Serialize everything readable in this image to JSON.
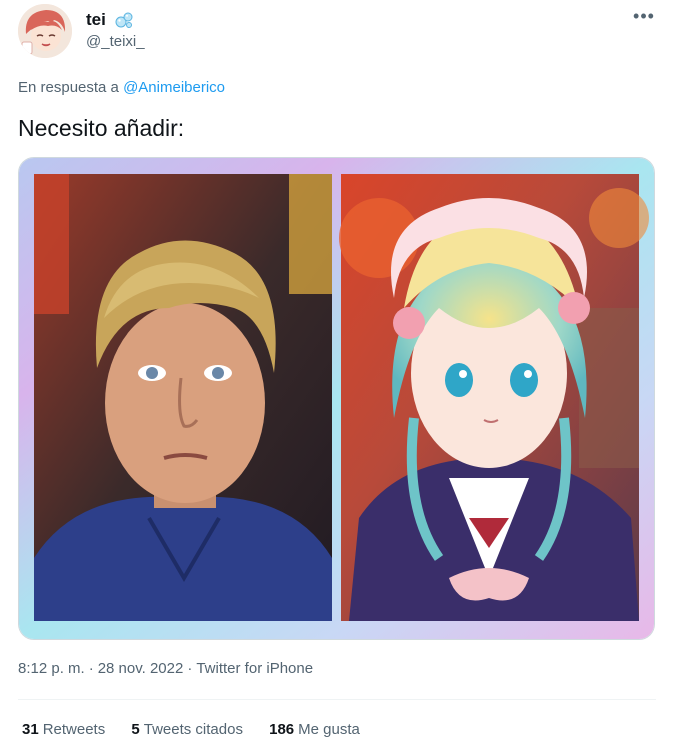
{
  "author": {
    "display_name": "tei",
    "name_emoji_icon": "bubbles-icon",
    "handle": "@_teixi_",
    "avatar_icon": "anime-avatar"
  },
  "reply": {
    "prefix": "En respuesta a",
    "mention": "@Animeiberico"
  },
  "tweet": {
    "text": "Necesito añadir:",
    "media_description_left": "photo",
    "media_description_right": "anime illustration"
  },
  "meta": {
    "time": "8:12 p. m.",
    "date": "28 nov. 2022",
    "client": "Twitter for iPhone",
    "separator": "·"
  },
  "stats": {
    "retweets_count": "31",
    "retweets_label": "Retweets",
    "quotes_count": "5",
    "quotes_label": "Tweets citados",
    "likes_count": "186",
    "likes_label": "Me gusta"
  },
  "colors": {
    "link": "#1d9bf0",
    "secondary_text": "#536471",
    "primary_text": "#0f1419"
  }
}
